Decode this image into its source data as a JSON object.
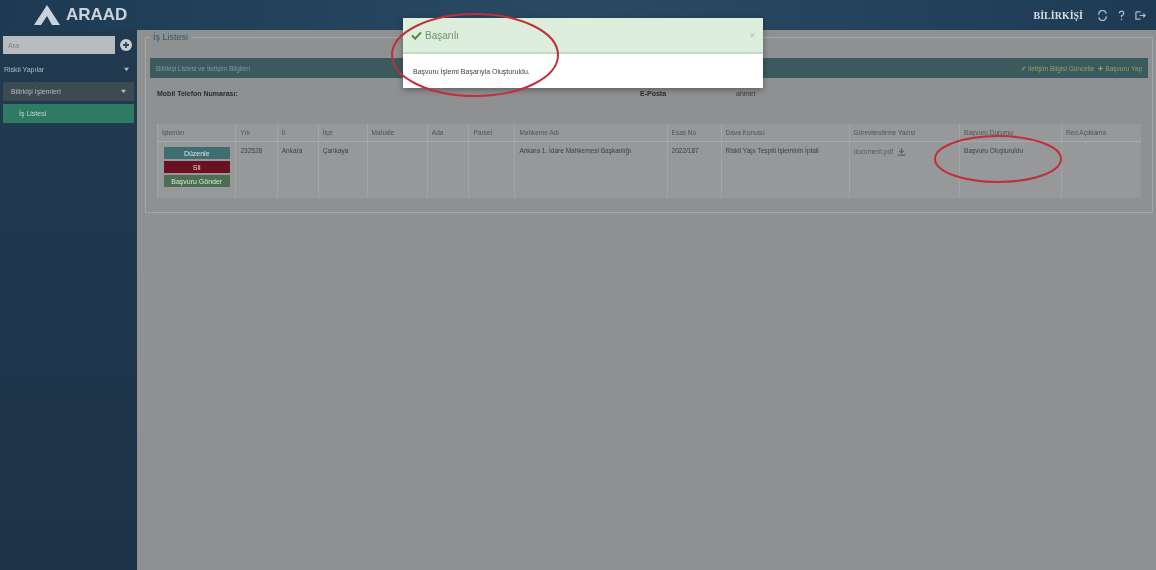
{
  "header": {
    "logo": "ARAAD",
    "user": "BİLİRKİŞİ"
  },
  "sidebar": {
    "search": {
      "placeholder": "Ara"
    },
    "items": [
      {
        "label": "Riskli Yapılar",
        "expanded": true,
        "selected": false,
        "children": [
          {
            "label": "Bilirkişi İşlemleri",
            "expanded": true,
            "selected": false,
            "children": [
              {
                "label": "İş Listesi",
                "selected": true
              }
            ]
          }
        ]
      }
    ]
  },
  "main": {
    "legend": "İş Listesi",
    "panel": {
      "title": "Bilirkişi Listesi ve İletişim Bilgileri",
      "buttons": [
        {
          "label": "İletişim Bilgisi Güncelle",
          "kind": "edit"
        },
        {
          "label": "Başvuru Yap",
          "kind": "add"
        }
      ]
    },
    "contact": {
      "phone_label": "Mobil Telefon Numarası:",
      "email_label": "E-Posta",
      "email_value": "ahmet"
    },
    "table": {
      "columns": [
        "İşlemler",
        "Yılı",
        "İl",
        "İlçe",
        "Mahalle",
        "Ada",
        "Parsel",
        "Mahkeme Adı",
        "Esas No",
        "Dava Konusu",
        "Görevlendirme Yazısı",
        "Başvuru Durumu",
        "Red Açıklama"
      ],
      "rows": [
        {
          "cells": [
            {
              "kind": "actions",
              "buttons": [
                {
                  "label": "Düzenle",
                  "kind": "edit"
                },
                {
                  "label": "Sil",
                  "kind": "delete"
                },
                {
                  "label": "Başvuru Gönder",
                  "kind": "send"
                }
              ]
            },
            {
              "kind": "text",
              "text": "232528"
            },
            {
              "kind": "text",
              "text": "Ankara"
            },
            {
              "kind": "text",
              "text": "Çankaya"
            },
            {
              "kind": "text",
              "text": ""
            },
            {
              "kind": "text",
              "text": ""
            },
            {
              "kind": "text",
              "text": ""
            },
            {
              "kind": "text",
              "text": "Ankara 1. İdare Mahkemesi Başkanlığı"
            },
            {
              "kind": "text",
              "text": "2022/187"
            },
            {
              "kind": "text",
              "text": "Riskli Yapı Tespiti İşleminin İptali"
            },
            {
              "kind": "file",
              "text": "document.pdf"
            },
            {
              "kind": "text",
              "text": "Başvuru Oluşturuldu"
            },
            {
              "kind": "text",
              "text": ""
            }
          ]
        }
      ]
    }
  },
  "dialog": {
    "kind": "success",
    "title": "Başarılı",
    "close": "×",
    "message": "Başvuru İşlemi Başarıyla Oluşturuldu."
  }
}
